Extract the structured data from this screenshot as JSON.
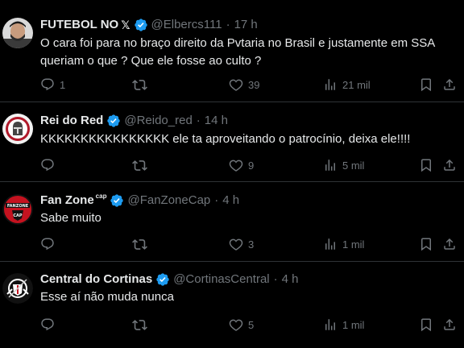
{
  "colors": {
    "background": "#000000",
    "text": "#e7e9ea",
    "secondary": "#71767b",
    "verified": "#1d9bf0",
    "divider": "#2f3336"
  },
  "tweets": [
    {
      "name": "FUTEBOL NO",
      "name_logo": "𝕏",
      "handle": "@Elbercs111",
      "separator": "·",
      "time": "17 h",
      "text": "O cara foi para no braço direito da Pvtaria no Brasil e justamente em SSA queriam o que ? Que ele fosse ao culto ?",
      "replies": "1",
      "retweets": "",
      "likes": "39",
      "views": "21 mil",
      "avatar_icon": "person-photo-icon"
    },
    {
      "name": "Rei do Red",
      "handle": "@Reido_red",
      "separator": "·",
      "time": "14 h",
      "text": "KKKKKKKKKKKKKKKK ele ta aproveitando o patrocínio, deixa ele!!!!",
      "replies": "",
      "retweets": "",
      "likes": "9",
      "views": "5 mil",
      "avatar_icon": "knight-crest-icon"
    },
    {
      "name": "Fan Zone",
      "name_suffix": "cap",
      "handle": "@FanZoneCap",
      "separator": "·",
      "time": "4 h",
      "text": "Sabe muito",
      "replies": "",
      "retweets": "",
      "likes": "3",
      "views": "1 mil",
      "avatar_icon": "fanzone-badge-icon",
      "avatar_text": "FANZONE",
      "avatar_subtext": "CAP"
    },
    {
      "name": "Central do Cortinas",
      "handle": "@CortinasCentral",
      "separator": "·",
      "time": "4 h",
      "text": "Esse aí não muda nunca",
      "replies": "",
      "retweets": "",
      "likes": "5",
      "views": "1 mil",
      "avatar_icon": "corinthians-crest-icon"
    }
  ]
}
